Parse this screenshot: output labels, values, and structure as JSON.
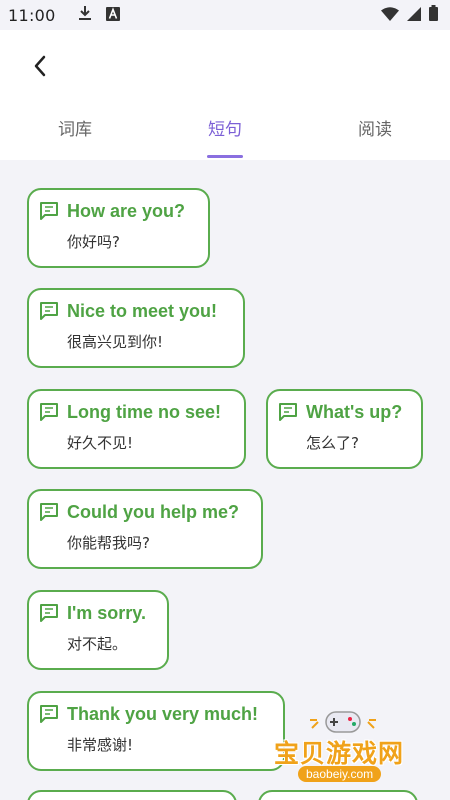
{
  "status_bar": {
    "time": "11:00",
    "icons": [
      "download-icon",
      "a-letter-icon",
      "wifi-icon",
      "signal-icon",
      "battery-icon"
    ]
  },
  "header": {
    "back_icon": "chevron-left-icon"
  },
  "tabs": [
    {
      "label": "词库",
      "active": false
    },
    {
      "label": "短句",
      "active": true
    },
    {
      "label": "阅读",
      "active": false
    }
  ],
  "colors": {
    "accent": "#7b5fd6",
    "card_border": "#5aac4e",
    "card_text": "#4fa344",
    "background": "#f3f3f8"
  },
  "phrases": [
    {
      "en": "How are you?",
      "cn": "你好吗?"
    },
    {
      "en": "Nice to meet you!",
      "cn": "很高兴见到你!"
    },
    {
      "en": "Long time no see!",
      "cn": "好久不见!"
    },
    {
      "en": "What's up?",
      "cn": "怎么了?"
    },
    {
      "en": "Could you help me?",
      "cn": "你能帮我吗?"
    },
    {
      "en": "I'm sorry.",
      "cn": "对不起。"
    },
    {
      "en": "Thank you very much!",
      "cn": "非常感谢!"
    }
  ],
  "watermark": {
    "text": "宝贝游戏网",
    "url": "baobeiy.com"
  }
}
